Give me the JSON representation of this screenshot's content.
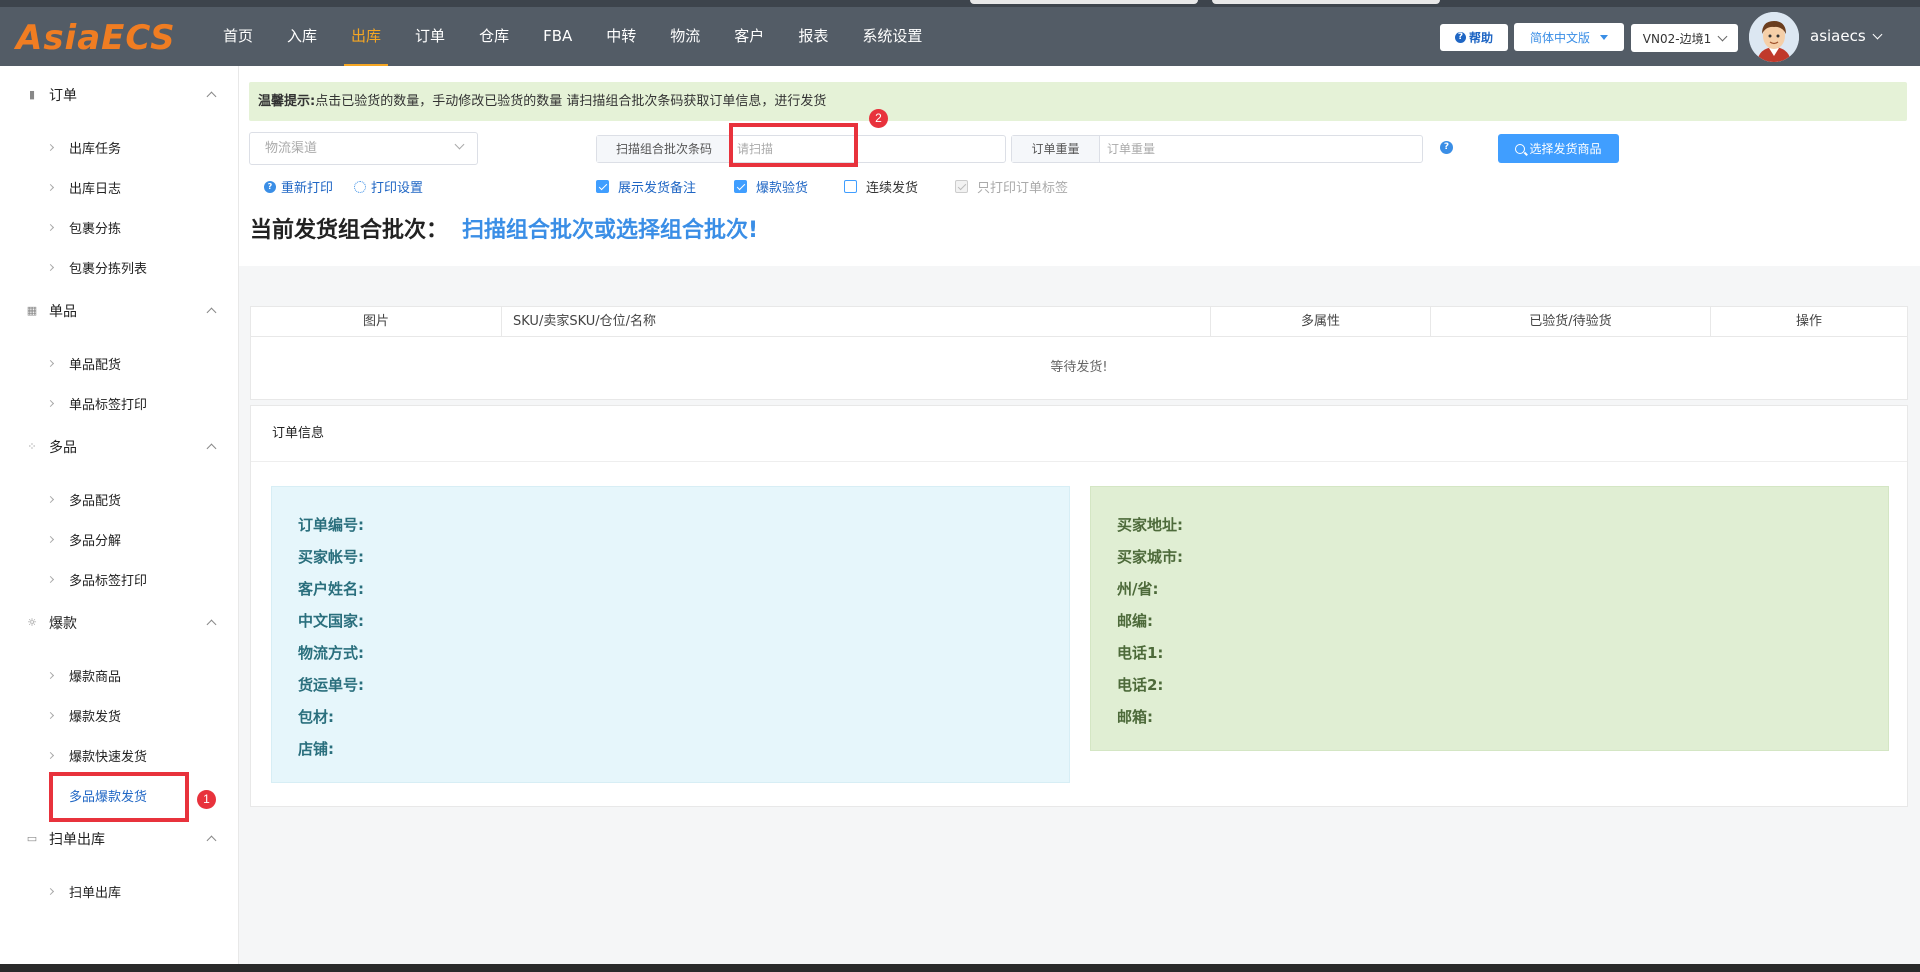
{
  "brand": {
    "logo_text": "AsiaECS",
    "logo_color": "#f07d22",
    "accent": "#f5a623",
    "primary": "#409eff"
  },
  "topnav": {
    "items": [
      "首页",
      "入库",
      "出库",
      "订单",
      "仓库",
      "FBA",
      "中转",
      "物流",
      "客户",
      "报表",
      "系统设置"
    ],
    "active": "出库"
  },
  "header_right": {
    "help": "帮助",
    "language": "简体中文版",
    "warehouse": "VN02-边境1",
    "username": "asiaecs"
  },
  "sidebar": {
    "sections": [
      {
        "title": "订单",
        "icon": "trash-icon",
        "items": [
          "出库任务",
          "出库日志",
          "包裹分拣",
          "包裹分拣列表"
        ]
      },
      {
        "title": "单品",
        "icon": "grid-icon",
        "items": [
          "单品配货",
          "单品标签打印"
        ]
      },
      {
        "title": "多品",
        "icon": "dots-grid-icon",
        "items": [
          "多品配货",
          "多品分解",
          "多品标签打印"
        ]
      },
      {
        "title": "爆款",
        "icon": "sun-icon",
        "items": [
          "爆款商品",
          "爆款发货",
          "爆款快速发货",
          "多品爆款发货"
        ]
      },
      {
        "title": "扫单出库",
        "icon": "box-icon",
        "items": [
          "扫单出库"
        ]
      }
    ],
    "active_item": "多品爆款发货"
  },
  "annotations": {
    "badge1": "1",
    "badge2": "2"
  },
  "main": {
    "tip_label": "温馨提示:",
    "tip_text": "点击已验货的数量，手动修改已验货的数量 请扫描组合批次条码获取订单信息，进行发货",
    "channel_placeholder": "物流渠道",
    "scan_addon": "扫描组合批次条码",
    "scan_placeholder": "请扫描",
    "weight_addon": "订单重量",
    "weight_placeholder": "订单重量",
    "select_button": "选择发货商品",
    "reprint": "重新打印",
    "print_settings": "打印设置",
    "checkboxes": [
      {
        "label": "展示发货备注",
        "checked": true
      },
      {
        "label": "爆款验货",
        "checked": true
      },
      {
        "label": "连续发货",
        "checked": false
      },
      {
        "label": "只打印订单标签",
        "checked": true,
        "disabled": true
      }
    ],
    "batch_label": "当前发货组合批次：",
    "batch_hint": "扫描组合批次或选择组合批次!",
    "table": {
      "columns": [
        "图片",
        "SKU/卖家SKU/仓位/名称",
        "多属性",
        "已验货/待验货",
        "操作"
      ],
      "empty_text": "等待发货!"
    },
    "order_info": {
      "title": "订单信息",
      "left_fields": [
        "订单编号:",
        "买家帐号:",
        "客户姓名:",
        "中文国家:",
        "物流方式:",
        "货运单号:",
        "包材:",
        "店铺:"
      ],
      "right_fields": [
        "买家地址:",
        "买家城市:",
        "州/省:",
        "邮编:",
        "电话1:",
        "电话2:",
        "邮箱:"
      ]
    }
  }
}
